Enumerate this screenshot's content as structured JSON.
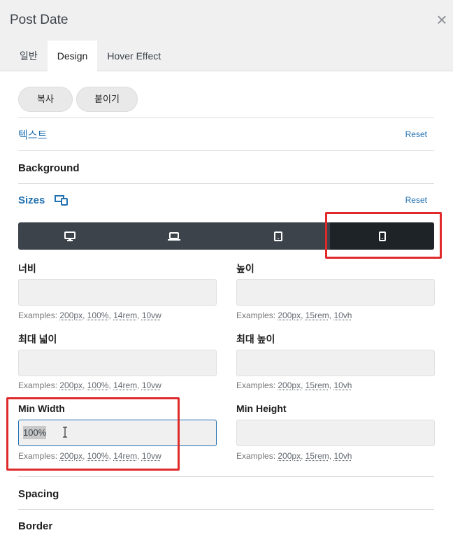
{
  "panel": {
    "title": "Post Date"
  },
  "tabs": [
    {
      "label": "일반"
    },
    {
      "label": "Design"
    },
    {
      "label": "Hover Effect"
    }
  ],
  "actions": {
    "copy_label": "복사",
    "paste_label": "붙이기"
  },
  "sections": {
    "text": {
      "title": "텍스트",
      "reset": "Reset"
    },
    "background": {
      "title": "Background"
    },
    "sizes": {
      "title": "Sizes",
      "reset": "Reset",
      "active_device": "mobile"
    },
    "spacing": {
      "title": "Spacing"
    },
    "border": {
      "title": "Border"
    }
  },
  "devices": [
    {
      "name": "desktop-icon"
    },
    {
      "name": "laptop-icon"
    },
    {
      "name": "tablet-icon"
    },
    {
      "name": "mobile-icon"
    }
  ],
  "fields": {
    "width": {
      "label": "너비",
      "value": "",
      "examples": [
        "200px",
        "100%",
        "14rem",
        "10vw"
      ]
    },
    "height": {
      "label": "높이",
      "value": "",
      "examples": [
        "200px",
        "15rem",
        "10vh"
      ]
    },
    "max_width": {
      "label": "최대 넓이",
      "value": "",
      "examples": [
        "200px",
        "100%",
        "14rem",
        "10vw"
      ]
    },
    "max_height": {
      "label": "최대 높이",
      "value": "",
      "examples": [
        "200px",
        "15rem",
        "10vh"
      ]
    },
    "min_width": {
      "label": "Min Width",
      "value": "100%",
      "examples": [
        "200px",
        "100%",
        "14rem",
        "10vw"
      ]
    },
    "min_height": {
      "label": "Min Height",
      "value": "",
      "examples": [
        "200px",
        "15rem",
        "10vh"
      ]
    }
  },
  "examples_prefix": "Examples:",
  "colors": {
    "accent": "#2271b1",
    "device_bar": "#3c434a",
    "device_active": "#1d2327",
    "highlight": "#e02a2a"
  }
}
